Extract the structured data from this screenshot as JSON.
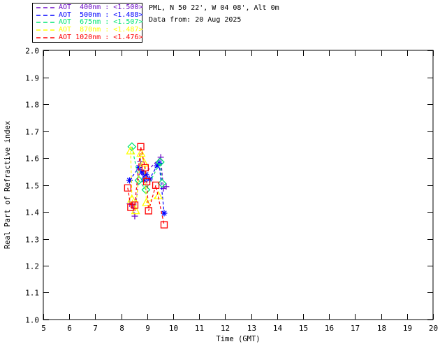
{
  "header": {
    "location": "PML, N 50 22', W 04 08', Alt 0m",
    "data_from": "Data from: 20 Aug 2025"
  },
  "legend": {
    "items": [
      {
        "label": "AOT  400nm : <1.500>",
        "color": "#6E0DC8"
      },
      {
        "label": "AOT  500nm : <1.488>",
        "color": "#0000FF"
      },
      {
        "label": "AOT  675nm : <1.507>",
        "color": "#00E673"
      },
      {
        "label": "AOT  870nm : <1.487>",
        "color": "#FFFF00"
      },
      {
        "label": "AOT 1020nm : <1.476>",
        "color": "#FF0000"
      }
    ]
  },
  "chart_data": {
    "type": "line",
    "title": "",
    "xlabel": "Time (GMT)",
    "ylabel": "Real Part of Refractive index",
    "xlim": [
      5,
      20
    ],
    "ylim": [
      1.0,
      2.0
    ],
    "xticks": [
      5,
      6,
      7,
      8,
      9,
      10,
      11,
      12,
      13,
      14,
      15,
      16,
      17,
      18,
      19,
      20
    ],
    "yticks": [
      1.0,
      1.1,
      1.2,
      1.3,
      1.4,
      1.5,
      1.6,
      1.7,
      1.8,
      1.9,
      2.0
    ],
    "grid": false,
    "line_style": "dashed",
    "legend_position": "outside-top-left",
    "axis_color": "#000000",
    "series": [
      {
        "name": "AOT 400nm",
        "mean_label": "<1.500>",
        "color": "#6E0DC8",
        "marker": "plus",
        "points": [
          [
            8.33,
            1.43
          ],
          [
            8.43,
            1.426
          ],
          [
            8.52,
            1.384
          ],
          [
            8.74,
            1.588
          ],
          [
            8.88,
            1.54
          ],
          [
            9.52,
            1.603
          ],
          [
            9.62,
            1.487
          ],
          [
            9.73,
            1.494
          ]
        ]
      },
      {
        "name": "AOT 500nm",
        "mean_label": "<1.488>",
        "color": "#0000FF",
        "marker": "asterisk",
        "points": [
          [
            8.32,
            1.517
          ],
          [
            8.68,
            1.565
          ],
          [
            8.79,
            1.548
          ],
          [
            8.88,
            1.519
          ],
          [
            8.95,
            1.538
          ],
          [
            9.09,
            1.522
          ],
          [
            9.38,
            1.571
          ],
          [
            9.46,
            1.581
          ],
          [
            9.65,
            1.395
          ]
        ]
      },
      {
        "name": "AOT 675nm",
        "mean_label": "<1.507>",
        "color": "#00E673",
        "marker": "diamond",
        "points": [
          [
            8.41,
            1.642
          ],
          [
            8.68,
            1.517
          ],
          [
            8.95,
            1.482
          ],
          [
            9.5,
            1.585
          ],
          [
            9.57,
            1.506
          ]
        ]
      },
      {
        "name": "AOT 870nm",
        "mean_label": "<1.487>",
        "color": "#FFFF00",
        "marker": "triangle",
        "points": [
          [
            8.36,
            1.627
          ],
          [
            8.41,
            1.448
          ],
          [
            8.55,
            1.405
          ],
          [
            8.76,
            1.618
          ],
          [
            8.88,
            1.582
          ],
          [
            8.97,
            1.435
          ],
          [
            9.43,
            1.46
          ]
        ]
      },
      {
        "name": "AOT 1020nm",
        "mean_label": "<1.476>",
        "color": "#FF0000",
        "marker": "square",
        "points": [
          [
            8.25,
            1.489
          ],
          [
            8.37,
            1.417
          ],
          [
            8.52,
            1.425
          ],
          [
            8.75,
            1.642
          ],
          [
            8.92,
            1.564
          ],
          [
            8.98,
            1.512
          ],
          [
            9.05,
            1.404
          ],
          [
            9.33,
            1.499
          ],
          [
            9.65,
            1.352
          ]
        ]
      }
    ]
  }
}
